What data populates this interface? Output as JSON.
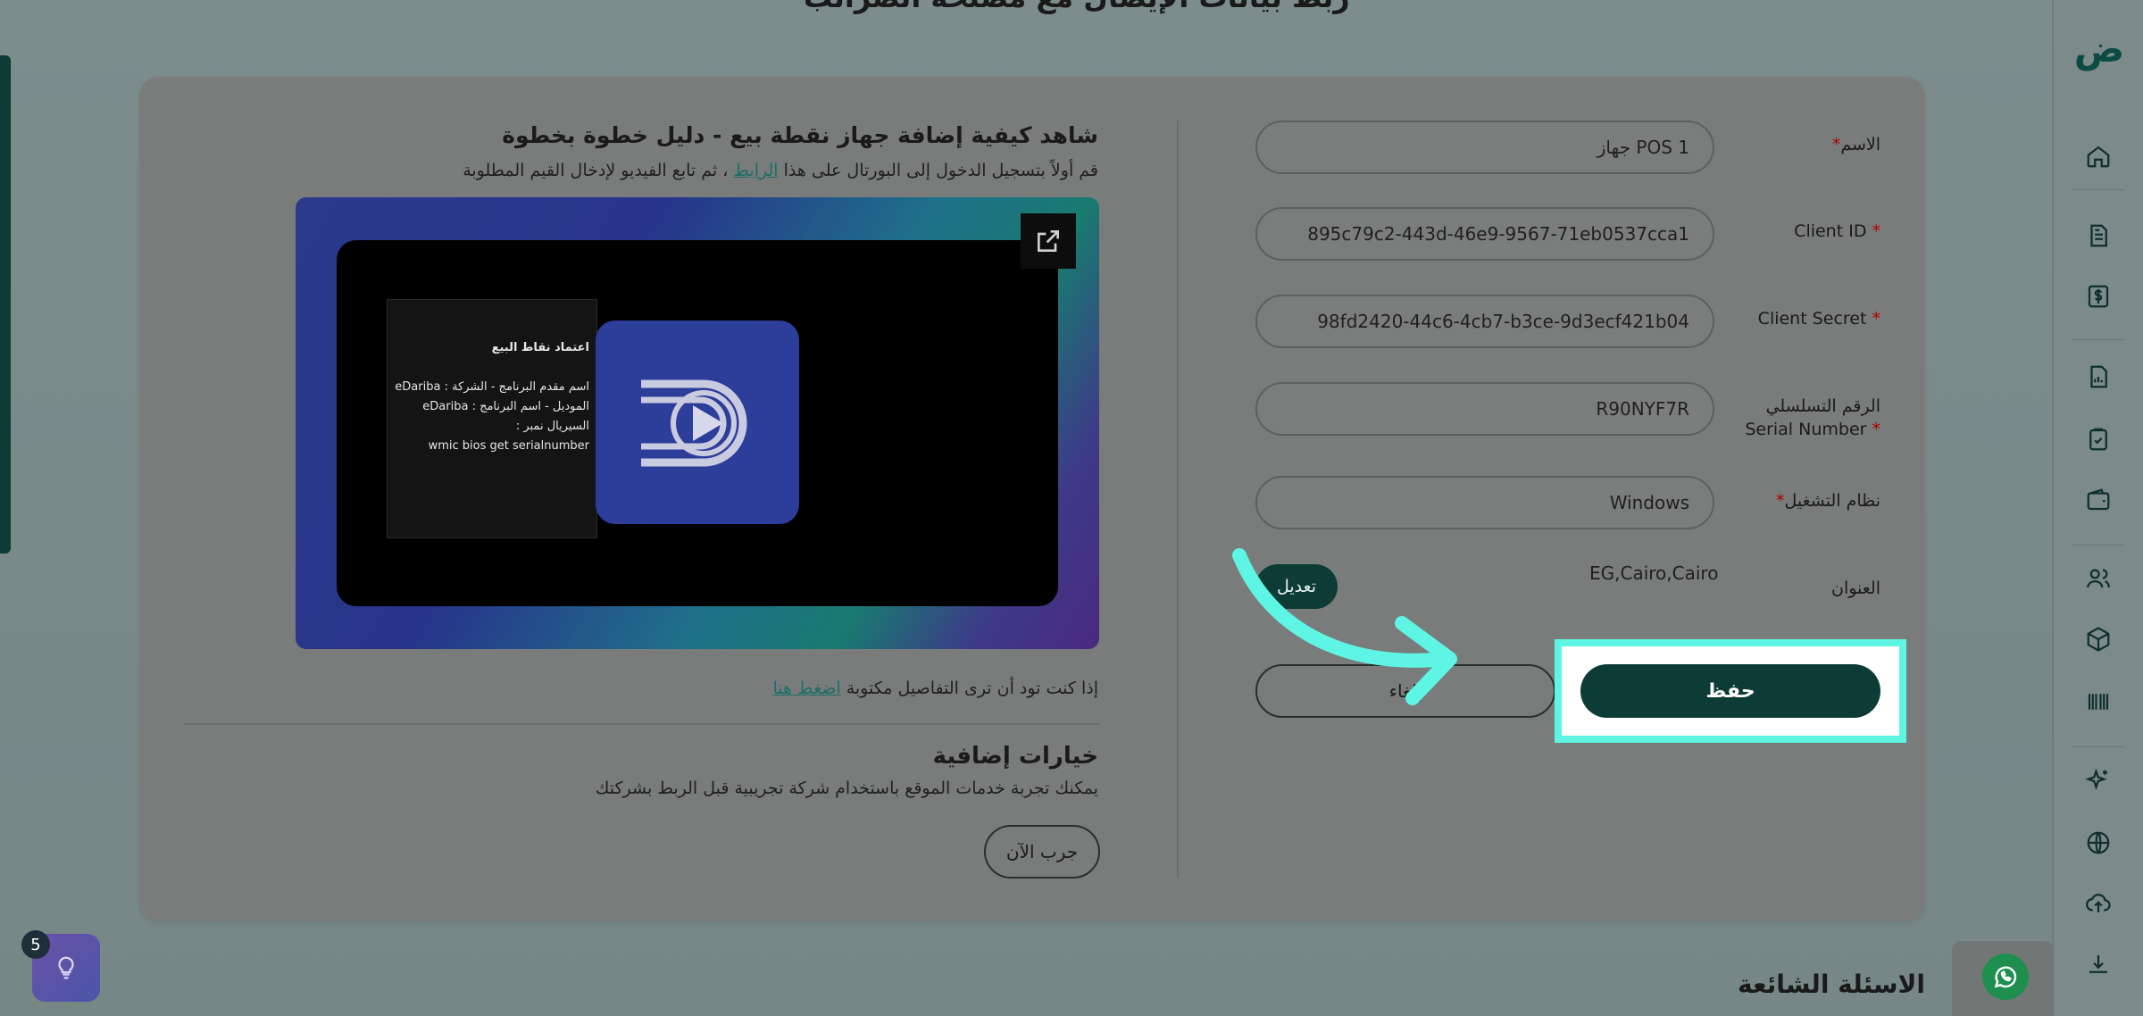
{
  "page": {
    "top_title": "ربط بيانات الإيصال مع مصلحة الضرائب",
    "faq_title": "الاسئلة الشائعة",
    "hint_badge_count": "5"
  },
  "sidebar": {
    "logo": "ض",
    "icons": [
      "home-icon",
      "document-icon",
      "dollar-icon",
      "report-icon",
      "checklist-icon",
      "wallet-icon",
      "users-icon",
      "box-icon",
      "barcode-icon",
      "sparkle-icon",
      "globe-icon",
      "upload-icon",
      "download-icon"
    ]
  },
  "form": {
    "fields": [
      {
        "label": "الاسم",
        "required": "*",
        "value": "جهاز POS 1"
      },
      {
        "label": "Client ID",
        "required": "*",
        "value": "895c79c2-443d-46e9-9567-71eb0537cca1"
      },
      {
        "label": "Client Secret",
        "required": "*",
        "value": "98fd2420-44c6-4cb7-b3ce-9d3ecf421b04"
      },
      {
        "label_line1": "الرقم التسلسلي",
        "label_line2": "Serial Number",
        "required": "*",
        "value": "R90NYF7R"
      },
      {
        "label": "نظام التشغيل",
        "required": "*",
        "value": "Windows"
      }
    ],
    "address_label": "العنوان",
    "address_value": "EG,Cairo,Cairo",
    "edit_label": "تعديل",
    "cancel_label": "إلغاء",
    "save_label": "حفظ"
  },
  "video": {
    "title": "شاهد كيفية إضافة جهاز نقطة بيع - دليل خطوة بخطوة",
    "sub_before": "قم أولاً بتسجيل الدخول إلى البورتال على هذا ",
    "sub_link": "الرابط",
    "sub_after": " ، ثم تابع الفيديو لإدخال القيم المطلوبة",
    "notepad_lines": [
      "اعتماد نقاط البيع",
      "اسم مقدم البرنامج - الشركة : eDariba",
      "الموديل - اسم البرنامج : eDariba",
      "السيريال نمبر :",
      "wmic bios get serialnumber"
    ],
    "written_before": "إذا كنت تود أن ترى التفاصيل مكتوبة ",
    "written_link": "اضغط هنا"
  },
  "extra": {
    "title": "خيارات إضافية",
    "subtitle": "يمكنك تجربة خدمات الموقع باستخدام شركة تجريبية قبل الربط بشركتك",
    "try_label": "جرب الآن"
  },
  "colors": {
    "primary": "#0d3b36",
    "highlight": "#5ef5e4",
    "link": "#1c6e68"
  }
}
